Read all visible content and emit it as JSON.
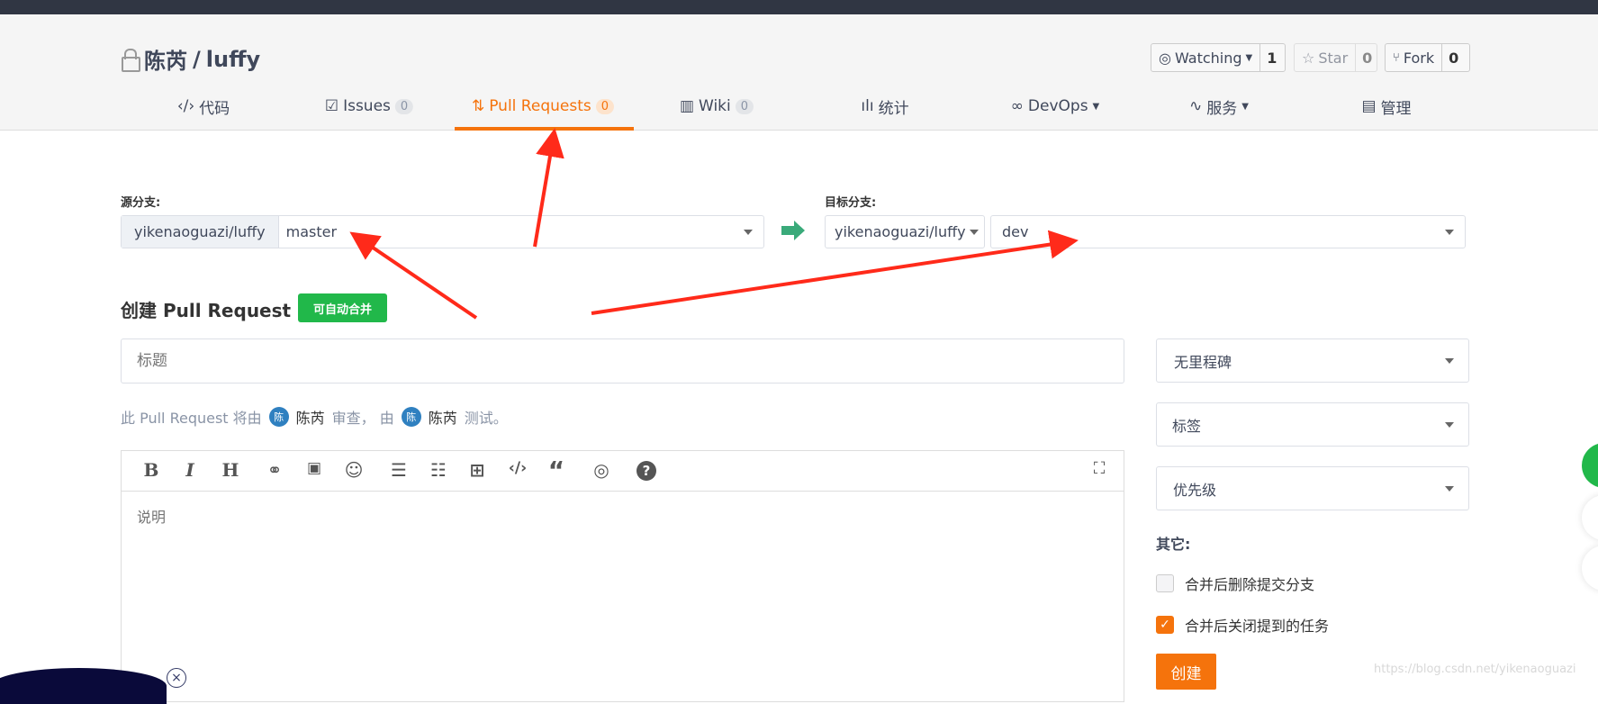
{
  "repo": {
    "owner": "陈芮",
    "name": "luffy",
    "separator": " / "
  },
  "social": {
    "watch_label": "Watching",
    "watch_count": "1",
    "star_label": "Star",
    "star_count": "0",
    "fork_label": "Fork",
    "fork_count": "0"
  },
  "tabs": [
    {
      "label": "代码",
      "icon": "code-icon"
    },
    {
      "label": "Issues",
      "count": "0",
      "icon": "issues-icon"
    },
    {
      "label": "Pull Requests",
      "count": "0",
      "icon": "pull-request-icon",
      "active": true
    },
    {
      "label": "Wiki",
      "count": "0",
      "icon": "book-icon"
    },
    {
      "label": "统计",
      "icon": "bar-chart-icon"
    },
    {
      "label": "DevOps",
      "icon": "infinity-icon",
      "dropdown": true
    },
    {
      "label": "服务",
      "icon": "pulse-icon",
      "dropdown": true
    },
    {
      "label": "管理",
      "icon": "settings-doc-icon"
    }
  ],
  "source": {
    "label": "源分支:",
    "repo": "yikenaoguazi/luffy",
    "branch": "master"
  },
  "target": {
    "label": "目标分支:",
    "repo": "yikenaoguazi/luffy",
    "branch": "dev"
  },
  "create": {
    "heading": "创建 Pull Request",
    "badge": "可自动合并",
    "title_placeholder": "标题",
    "description_placeholder": "说明",
    "submit": "创建"
  },
  "review": {
    "prefix": "此 Pull Request 将由",
    "reviewer": "陈芮",
    "reviewer_avatar": "陈",
    "mid": "审查， 由",
    "tester": "陈芮",
    "tester_avatar": "陈",
    "suffix": "测试。"
  },
  "sidebar": {
    "milestone": "无里程碑",
    "labels": "标签",
    "priority": "优先级",
    "other_label": "其它:",
    "options": [
      {
        "label": "合并后删除提交分支",
        "checked": false
      },
      {
        "label": "合并后关闭提到的任务",
        "checked": true
      }
    ]
  },
  "watermark": "https://blog.csdn.net/yikenaoguazi",
  "colors": {
    "accent": "#f5730c",
    "success": "#21b84a",
    "header_bg": "#f5f5f5",
    "topbar": "#303643",
    "annotation": "#ff2a1a"
  }
}
